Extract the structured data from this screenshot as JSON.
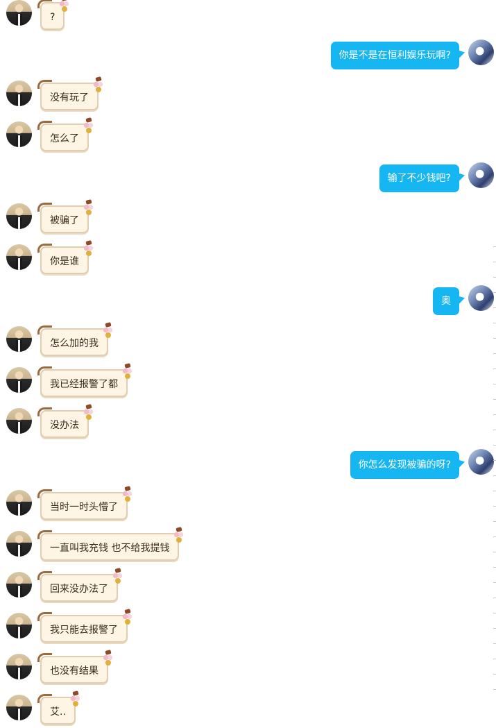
{
  "messages": [
    {
      "side": "left",
      "text": "?"
    },
    {
      "side": "right",
      "text": "你是不是在恒利娱乐玩啊?"
    },
    {
      "side": "left",
      "text": "没有玩了"
    },
    {
      "side": "left",
      "text": "怎么了"
    },
    {
      "side": "right",
      "text": "输了不少钱吧?"
    },
    {
      "side": "left",
      "text": "被骗了"
    },
    {
      "side": "left",
      "text": "你是谁"
    },
    {
      "side": "right",
      "text": "奥"
    },
    {
      "side": "left",
      "text": "怎么加的我"
    },
    {
      "side": "left",
      "text": "我已经报警了都"
    },
    {
      "side": "left",
      "text": "没办法"
    },
    {
      "side": "right",
      "text": "你怎么发现被骗的呀?"
    },
    {
      "side": "left",
      "text": "当时一时头懵了"
    },
    {
      "side": "left",
      "text": "一直叫我充钱 也不给我提钱"
    },
    {
      "side": "left",
      "text": "回来没办法了"
    },
    {
      "side": "left",
      "text": "我只能去报警了"
    },
    {
      "side": "left",
      "text": "也没有结果"
    },
    {
      "side": "left",
      "text": "艾.."
    }
  ],
  "colors": {
    "outgoing_bubble": "#16b6f2",
    "incoming_bubble": "#fff5e5",
    "incoming_border": "#e1cdb2"
  },
  "icons": {
    "incoming_decoration": "flower-ribbon-icon",
    "avatar_left": "contact-avatar",
    "avatar_right": "self-avatar"
  }
}
